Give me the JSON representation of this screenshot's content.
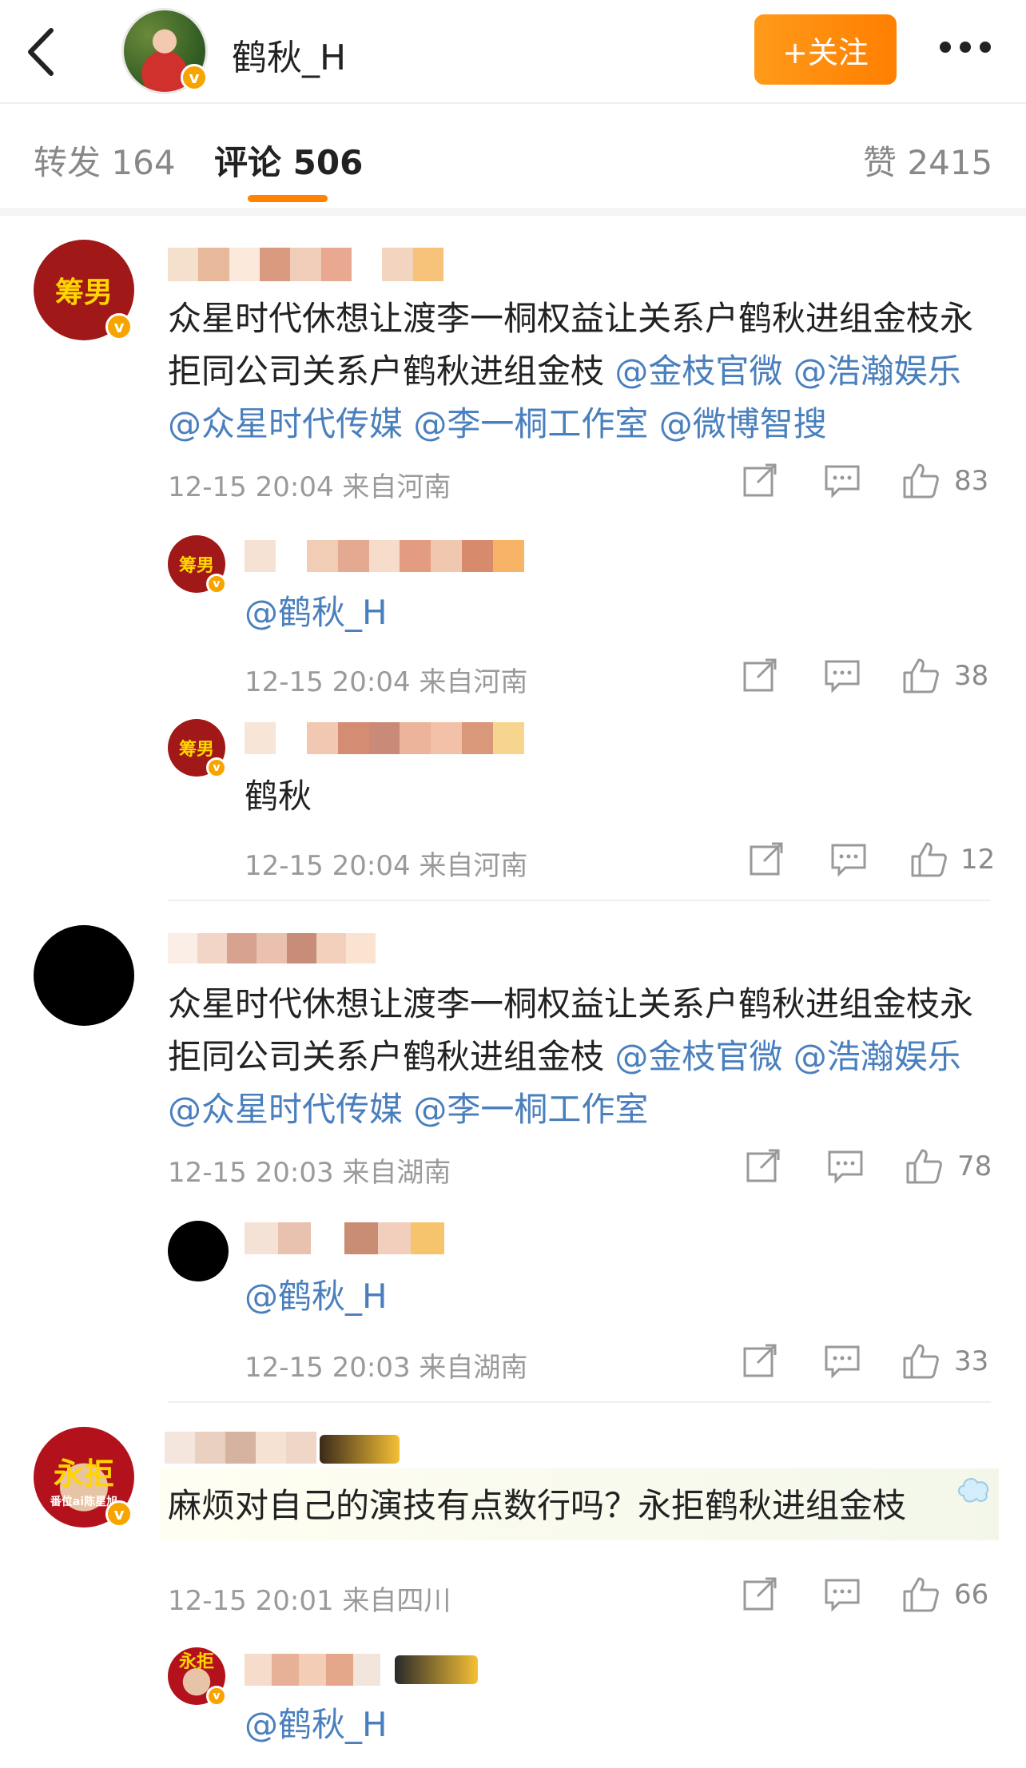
{
  "header": {
    "username": "鹤秋_H",
    "follow_label": "+关注"
  },
  "tabs": {
    "repost": {
      "label": "转发",
      "count": "164"
    },
    "comment": {
      "label": "评论",
      "count": "506"
    },
    "like": {
      "label": "赞",
      "count": "2415"
    }
  },
  "comments": [
    {
      "avatar_text": "筹男",
      "text": "众星时代休想让渡李一桐权益让关系户鹤秋进组金枝永拒同公司关系户鹤秋进组金枝",
      "mentions": [
        "@金枝官微",
        "@浩瀚娱乐",
        "@众星时代传媒",
        "@李一桐工作室",
        "@微博智搜"
      ],
      "time": "12-15 20:04",
      "location": "来自河南",
      "likes": "83",
      "replies": [
        {
          "avatar_text": "筹男",
          "text": "@鹤秋_H",
          "time": "12-15 20:04",
          "location": "来自河南",
          "likes": "38"
        },
        {
          "avatar_text": "筹男",
          "text": "鹤秋",
          "time": "12-15 20:04",
          "location": "来自河南",
          "likes": "12"
        }
      ]
    },
    {
      "text": "众星时代休想让渡李一桐权益让关系户鹤秋进组金枝永拒同公司关系户鹤秋进组金枝",
      "mentions": [
        "@金枝官微",
        "@浩瀚娱乐",
        "@众星时代传媒",
        "@李一桐工作室"
      ],
      "time": "12-15 20:03",
      "location": "来自湖南",
      "likes": "78",
      "replies": [
        {
          "text": "@鹤秋_H",
          "time": "12-15 20:03",
          "location": "来自湖南",
          "likes": "33"
        }
      ]
    },
    {
      "avatar_text": "永拒",
      "avatar_sub": "番位ai陈星旭",
      "text": "麻烦对自己的演技有点数行吗？永拒鹤秋进组金枝",
      "time": "12-15 20:01",
      "location": "来自四川",
      "likes": "66",
      "replies": [
        {
          "avatar_text": "永拒",
          "text": "@鹤秋_H"
        }
      ]
    }
  ],
  "colors": {
    "accent": "#ff8200",
    "mention": "#4a7fbd",
    "verified": "#f7a400"
  }
}
